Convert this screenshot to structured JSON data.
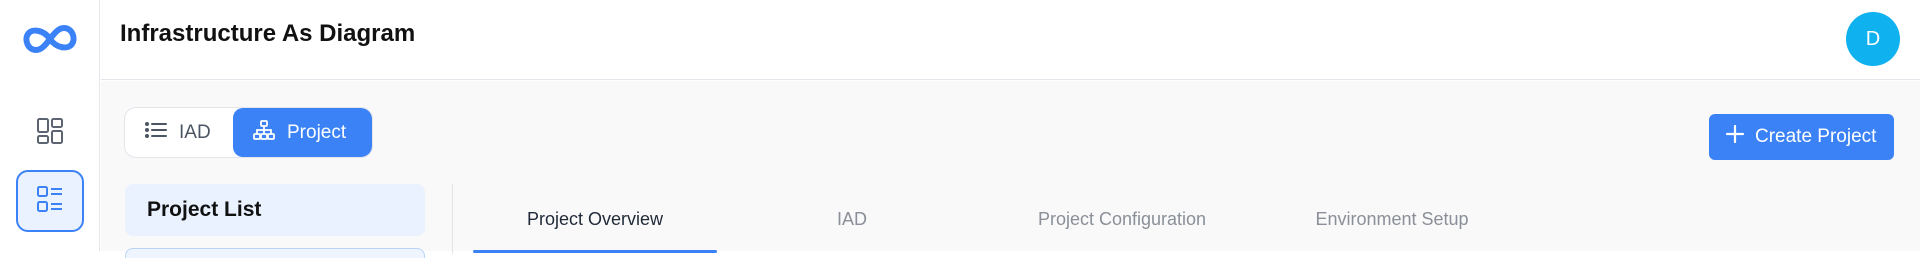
{
  "app": {
    "title": "Infrastructure As Diagram"
  },
  "user": {
    "avatar_initial": "D"
  },
  "view_toggle": {
    "options": [
      {
        "label": "IAD",
        "icon": "list-icon",
        "selected": false
      },
      {
        "label": "Project",
        "icon": "hierarchy-icon",
        "selected": true
      }
    ]
  },
  "actions": {
    "create_label": "Create Project",
    "create_icon": "plus-icon"
  },
  "project_list": {
    "title": "Project List"
  },
  "tabs": [
    {
      "label": "Project Overview",
      "active": true
    },
    {
      "label": "IAD",
      "active": false
    },
    {
      "label": "Project Configuration",
      "active": false
    },
    {
      "label": "Environment Setup",
      "active": false
    }
  ],
  "colors": {
    "accent": "#3b82f6",
    "avatar": "#0fb1ee",
    "panel_bg": "#eaf2ff"
  }
}
